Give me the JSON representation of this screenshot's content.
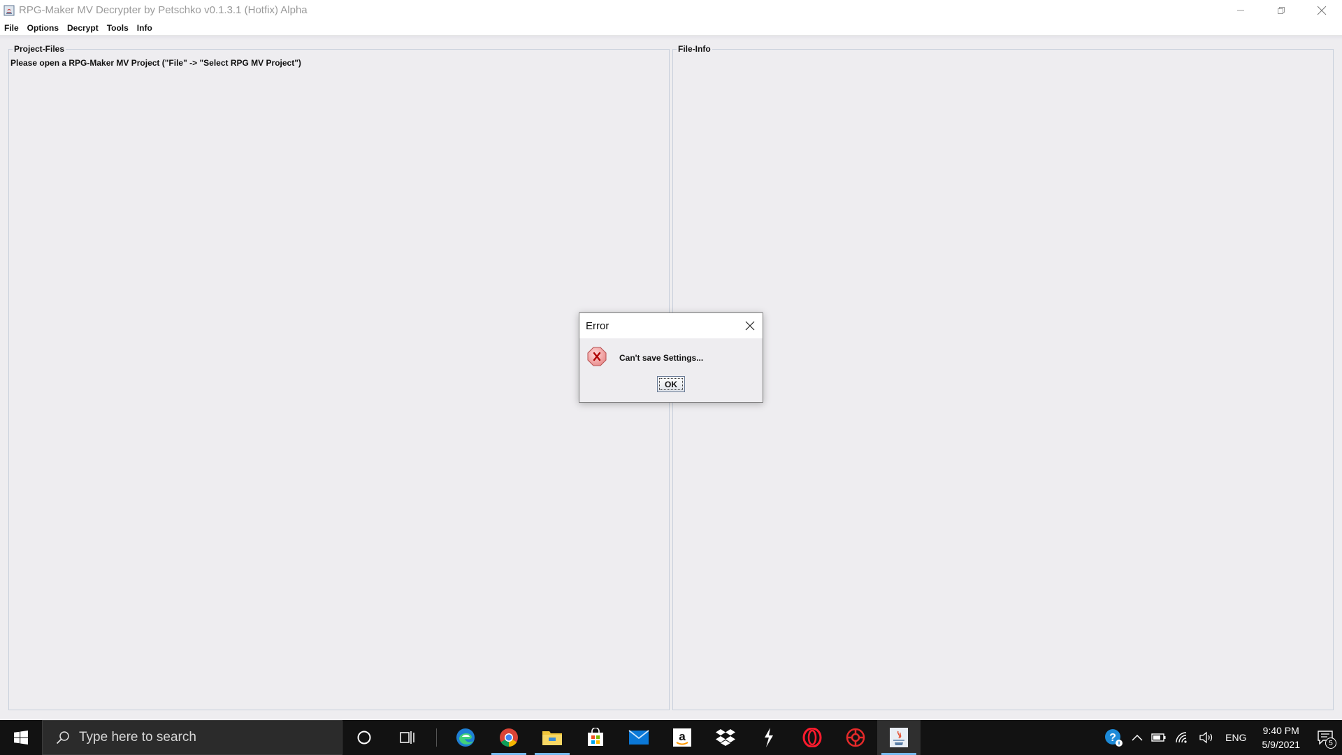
{
  "window": {
    "title": "RPG-Maker MV Decrypter by Petschko v0.1.3.1 (Hotfix) Alpha"
  },
  "menu": {
    "items": [
      "File",
      "Options",
      "Decrypt",
      "Tools",
      "Info"
    ]
  },
  "panels": {
    "project_files": {
      "title": "Project-Files",
      "message": "Please open a RPG-Maker MV Project (\"File\" -> \"Select RPG MV Project\")"
    },
    "file_info": {
      "title": "File-Info"
    }
  },
  "dialog": {
    "title": "Error",
    "message": "Can't save Settings...",
    "ok_label": "OK",
    "icon": "error-x-icon"
  },
  "taskbar": {
    "search_placeholder": "Type here to search",
    "apps": [
      "cortana",
      "task-view",
      "edge",
      "chrome",
      "file-explorer",
      "store",
      "mail",
      "amazon",
      "dropbox",
      "app-lightning",
      "opera",
      "app-red",
      "java"
    ],
    "tray": {
      "language": "ENG",
      "time": "9:40 PM",
      "date": "5/9/2021",
      "notification_count": "5"
    }
  },
  "colors": {
    "window_bg": "#eeedf0",
    "panel_border": "#c7cfdb",
    "taskbar_bg": "#121212",
    "taskbar_active": "#76b9ed"
  }
}
